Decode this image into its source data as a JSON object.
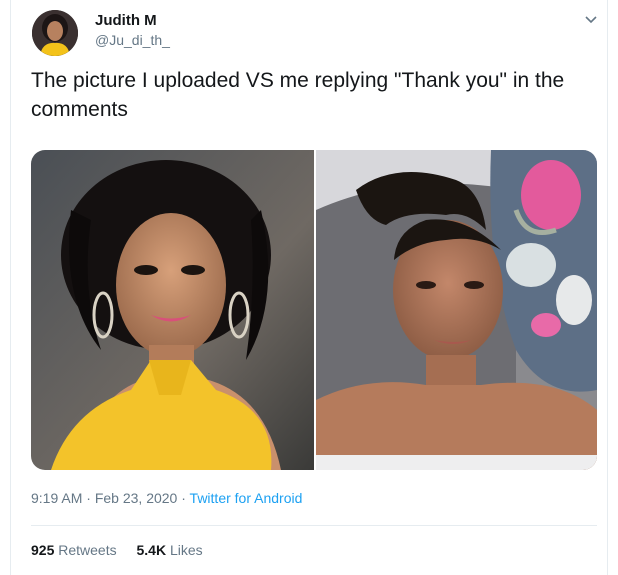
{
  "author": {
    "name": "Judith M",
    "handle": "@Ju_di_th_"
  },
  "tweet": {
    "text": "The picture I uploaded VS me replying \"Thank you\" in the comments"
  },
  "media": {
    "left_alt": "Glamorous photo",
    "right_alt": "No-makeup photo"
  },
  "meta": {
    "time": "9:19 AM",
    "sep1": " · ",
    "date": "Feb 23, 2020",
    "sep2": " · ",
    "source": "Twitter for Android"
  },
  "stats": {
    "retweets_count": "925",
    "retweets_label": " Retweets",
    "likes_count": "5.4K",
    "likes_label": " Likes"
  },
  "colors": {
    "link": "#1da1f2",
    "muted": "#657786",
    "divider": "#e6ecf0"
  },
  "icons": [
    "chevron-down-icon"
  ]
}
